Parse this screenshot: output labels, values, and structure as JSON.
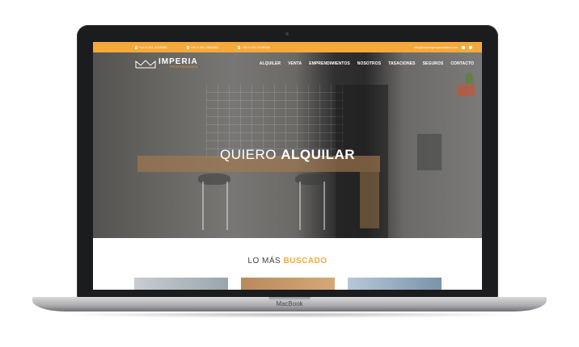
{
  "topbar": {
    "phones": [
      "+54 9 341 4195385",
      "+54 9 341 2550881",
      "+54 9 341 5156938"
    ],
    "email": "info@imperiapropiedades.com"
  },
  "logo": {
    "name": "IMPERIA",
    "sub": "PROPIEDADES"
  },
  "nav": {
    "items": [
      "ALQUILER",
      "VENTA",
      "EMPRENDIMIENTOS",
      "NOSOTROS",
      "TASACIONES",
      "SEGUROS",
      "CONTACTO"
    ]
  },
  "hero": {
    "title_light": "QUIERO",
    "title_bold": "ALQUILAR"
  },
  "section": {
    "title_light": "LO MÁS",
    "title_bold": "BUSCADO"
  },
  "laptop": {
    "brand": "MacBook"
  },
  "colors": {
    "accent": "#f5a93a",
    "frame": "#1b1c1e"
  }
}
